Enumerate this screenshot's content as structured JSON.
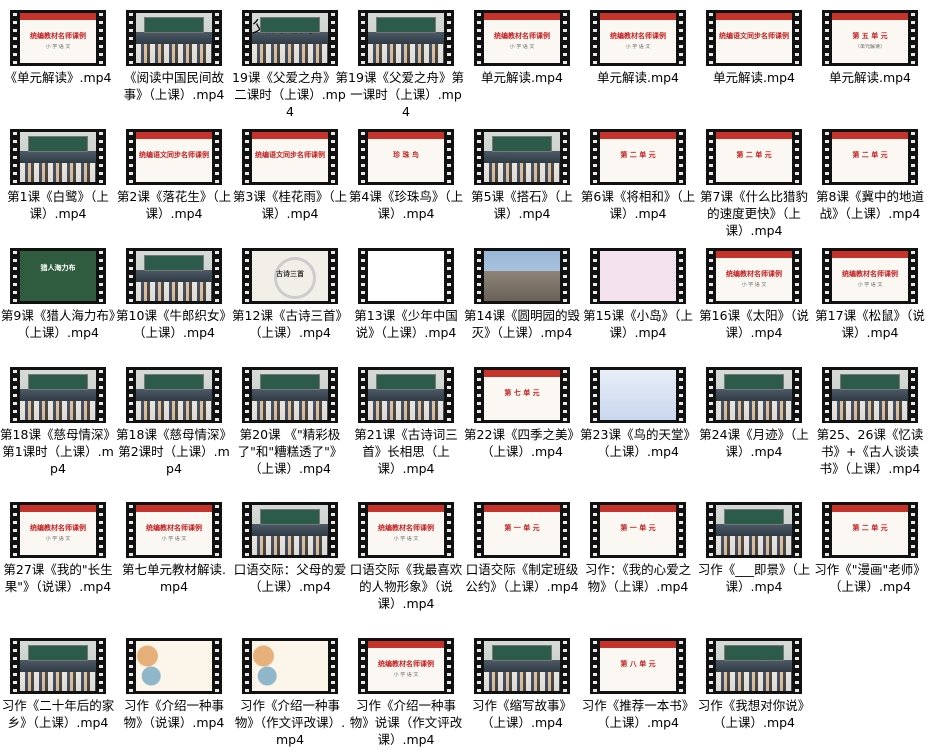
{
  "files": [
    {
      "name": "《单元解读》.mp4",
      "thumb": "slide",
      "thumb_title": "统编教材名师课例",
      "thumb_sub": "小 学 语 文"
    },
    {
      "name": "《阅读中国民间故事》（上课）.mp4",
      "thumb": "class",
      "thumb_title": "",
      "thumb_sub": ""
    },
    {
      "name": "19课《父爱之舟》第二课时（上课）.mp4",
      "thumb": "class",
      "thumb_title": "父爱之舟",
      "thumb_sub": ""
    },
    {
      "name": "19课《父爱之舟》第一课时（上课）.mp4",
      "thumb": "class",
      "thumb_title": "",
      "thumb_sub": ""
    },
    {
      "name": "单元解读.mp4",
      "thumb": "slide",
      "thumb_title": "统编教材名师课例",
      "thumb_sub": "小 学 语 文"
    },
    {
      "name": "单元解读.mp4",
      "thumb": "slide",
      "thumb_title": "统编教材名师课例",
      "thumb_sub": "小 学 语 文"
    },
    {
      "name": "单元解读.mp4",
      "thumb": "slide",
      "thumb_title": "统编语文同步名师课例",
      "thumb_sub": ""
    },
    {
      "name": "单元解读.mp4",
      "thumb": "slide",
      "thumb_title": "第 五 单 元",
      "thumb_sub": "（单元解读）"
    },
    {
      "name": "第1课《白鹭》（上课）.mp4",
      "thumb": "class",
      "thumb_title": "",
      "thumb_sub": ""
    },
    {
      "name": "第2课《落花生》（上课）.mp4",
      "thumb": "slide",
      "thumb_title": "统编语文同步名师课例",
      "thumb_sub": ""
    },
    {
      "name": "第3课《桂花雨》（上课）.mp4",
      "thumb": "slide",
      "thumb_title": "统编语文同步名师课例",
      "thumb_sub": ""
    },
    {
      "name": "第4课《珍珠鸟》（上课）.mp4",
      "thumb": "slide",
      "thumb_title": "珍 珠 鸟",
      "thumb_sub": ""
    },
    {
      "name": "第5课《搭石》（上课）.mp4",
      "thumb": "class",
      "thumb_title": "",
      "thumb_sub": ""
    },
    {
      "name": "第6课《将相和》（上课）.mp4",
      "thumb": "slide",
      "thumb_title": "第 二 单 元",
      "thumb_sub": ""
    },
    {
      "name": "第7课《什么比猎豹的速度更快》（上课）.mp4",
      "thumb": "slide",
      "thumb_title": "第 二 单 元",
      "thumb_sub": ""
    },
    {
      "name": "第8课《冀中的地道战》（上课）.mp4",
      "thumb": "slide",
      "thumb_title": "第 二 单 元",
      "thumb_sub": ""
    },
    {
      "name": "第9课《猎人海力布》（上课）.mp4",
      "thumb": "green",
      "thumb_title": "猎人海力布",
      "thumb_sub": ""
    },
    {
      "name": "第10课《牛郎织女》（上课）.mp4",
      "thumb": "class",
      "thumb_title": "",
      "thumb_sub": ""
    },
    {
      "name": "第12课《古诗三首》（上课）.mp4",
      "thumb": "ink",
      "thumb_title": "古诗三首",
      "thumb_sub": ""
    },
    {
      "name": "第13课《少年中国说》（上课）.mp4",
      "thumb": "redtext",
      "thumb_title": "",
      "thumb_sub": ""
    },
    {
      "name": "第14课《圆明园的毁灭》（上课）.mp4",
      "thumb": "photo",
      "thumb_title": "",
      "thumb_sub": ""
    },
    {
      "name": "第15课《小岛》（上课）.mp4",
      "thumb": "pink",
      "thumb_title": "",
      "thumb_sub": ""
    },
    {
      "name": "第16课《太阳》（说课）.mp4",
      "thumb": "slide",
      "thumb_title": "统编教材名师课例",
      "thumb_sub": "小 学 语 文"
    },
    {
      "name": "第17课《松鼠》（说课）.mp4",
      "thumb": "slide",
      "thumb_title": "统编教材名师课例",
      "thumb_sub": "小 学 语 文"
    },
    {
      "name": "第18课《慈母情深》第1课时（上课）.mp4",
      "thumb": "class",
      "thumb_title": "",
      "thumb_sub": ""
    },
    {
      "name": "第18课《慈母情深》第2课时（上课）.mp4",
      "thumb": "class",
      "thumb_title": "",
      "thumb_sub": ""
    },
    {
      "name": "第20课 《\"精彩极了\"和\"糟糕透了\"》（上课）.mp4",
      "thumb": "class",
      "thumb_title": "",
      "thumb_sub": ""
    },
    {
      "name": "第21课《古诗词三首》长相思（上课）.mp4",
      "thumb": "class",
      "thumb_title": "",
      "thumb_sub": ""
    },
    {
      "name": "第22课《四季之美》（上课）.mp4",
      "thumb": "slide",
      "thumb_title": "第 七 单 元",
      "thumb_sub": ""
    },
    {
      "name": "第23课《鸟的天堂》（上课）.mp4",
      "thumb": "blue",
      "thumb_title": "",
      "thumb_sub": ""
    },
    {
      "name": "第24课《月迹》（上课）.mp4",
      "thumb": "class",
      "thumb_title": "",
      "thumb_sub": ""
    },
    {
      "name": "第25、26课《忆读书》+《古人谈读书》（上课）.mp4",
      "thumb": "class",
      "thumb_title": "",
      "thumb_sub": ""
    },
    {
      "name": "第27课《我的\"长生果\"》（说课）.mp4",
      "thumb": "slide",
      "thumb_title": "统编教材名师课例",
      "thumb_sub": "小 学 语 文"
    },
    {
      "name": "第七单元教材解读.mp4",
      "thumb": "slide",
      "thumb_title": "统编教材名师课例",
      "thumb_sub": "小 学 语 文"
    },
    {
      "name": "口语交际：父母的爱（上课）.mp4",
      "thumb": "class",
      "thumb_title": "",
      "thumb_sub": ""
    },
    {
      "name": "口语交际《我最喜欢的人物形象》（说课）.mp4",
      "thumb": "slide",
      "thumb_title": "统编教材名师课例",
      "thumb_sub": "小 学 语 文"
    },
    {
      "name": "口语交际《制定班级公约》（上课）.mp4",
      "thumb": "slide",
      "thumb_title": "第 一 单 元",
      "thumb_sub": ""
    },
    {
      "name": "习作：《我的心爱之物》（上课）.mp4",
      "thumb": "slide",
      "thumb_title": "第 一 单 元",
      "thumb_sub": ""
    },
    {
      "name": "习作《___即景》（上课）.mp4",
      "thumb": "class",
      "thumb_title": "",
      "thumb_sub": ""
    },
    {
      "name": "习作《\"漫画\"老师》（上课）.mp4",
      "thumb": "slide",
      "thumb_title": "第 二 单 元",
      "thumb_sub": ""
    },
    {
      "name": "习作《二十年后的家乡》（上课）.mp4",
      "thumb": "class",
      "thumb_title": "",
      "thumb_sub": ""
    },
    {
      "name": "习作《介绍一种事物》（说课）.mp4",
      "thumb": "floral",
      "thumb_title": "",
      "thumb_sub": ""
    },
    {
      "name": "习作《介绍一种事物》（作文评改课）.mp4",
      "thumb": "floral",
      "thumb_title": "",
      "thumb_sub": ""
    },
    {
      "name": "习作《介绍一种事物》说课（作文评改课）.mp4",
      "thumb": "slide",
      "thumb_title": "统编教材名师课例",
      "thumb_sub": "小 学 语 文"
    },
    {
      "name": "习作《缩写故事》（上课）.mp4",
      "thumb": "class",
      "thumb_title": "",
      "thumb_sub": ""
    },
    {
      "name": "习作《推荐一本书》（上课）.mp4",
      "thumb": "slide",
      "thumb_title": "第 八 单 元",
      "thumb_sub": ""
    },
    {
      "name": "习作《我想对你说》（上课）.mp4",
      "thumb": "class",
      "thumb_title": "",
      "thumb_sub": ""
    }
  ]
}
